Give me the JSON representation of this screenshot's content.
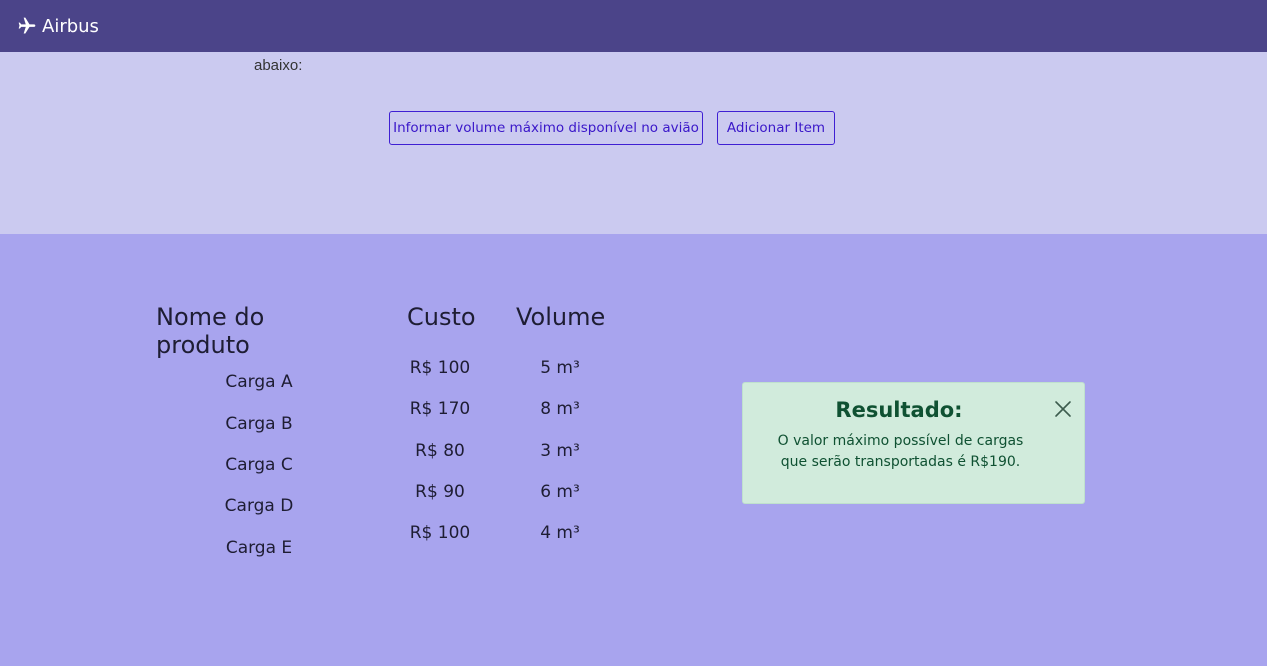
{
  "navbar": {
    "brand": "Airbus",
    "brand_icon": "airplane-icon"
  },
  "intro": {
    "tail": "abaixo:"
  },
  "actions": {
    "volume_label": "Informar volume máximo disponível no avião",
    "add_label": "Adicionar Item"
  },
  "table": {
    "headers": {
      "nome": "Nome do produto",
      "custo": "Custo",
      "volume": "Volume"
    },
    "rows": [
      {
        "nome": "Carga A",
        "custo": "R$ 100",
        "volume": "5 m³"
      },
      {
        "nome": "Carga B",
        "custo": "R$ 170",
        "volume": "8 m³"
      },
      {
        "nome": "Carga C",
        "custo": "R$ 80",
        "volume": "3 m³"
      },
      {
        "nome": "Carga D",
        "custo": "R$ 90",
        "volume": "6 m³"
      },
      {
        "nome": "Carga E",
        "custo": "R$ 100",
        "volume": "4 m³"
      }
    ]
  },
  "result": {
    "title": "Resultado:",
    "message": "O valor máximo possível de cargas que serão transportadas é R$190.",
    "close_icon": "close-icon"
  },
  "colors": {
    "navbar": "#4b4489",
    "top_section": "#cbcaf0",
    "page": "#a8a4ee",
    "accent": "#3f1fd3",
    "alert_bg": "#d1ebdc",
    "alert_text": "#0f5132"
  }
}
